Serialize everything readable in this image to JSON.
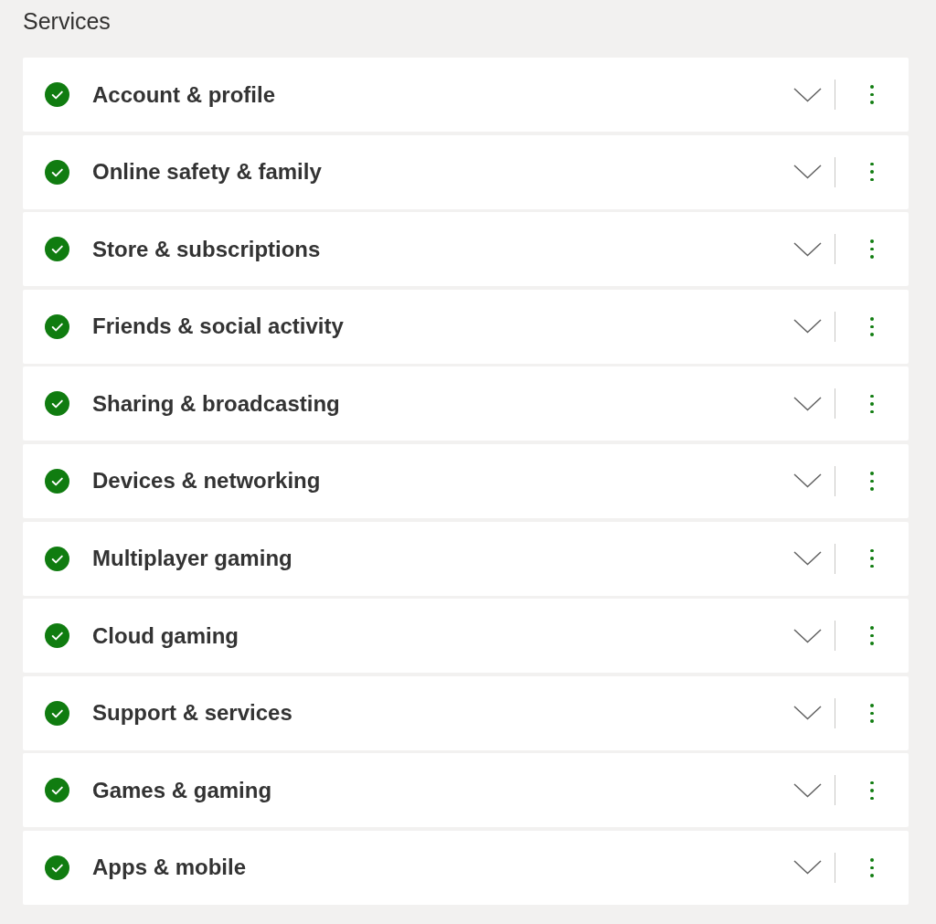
{
  "section": {
    "title": "Services"
  },
  "services": [
    {
      "name": "Account & profile",
      "healthy": true,
      "expanded": false
    },
    {
      "name": "Online safety & family",
      "healthy": true,
      "expanded": false
    },
    {
      "name": "Store & subscriptions",
      "healthy": true,
      "expanded": false
    },
    {
      "name": "Friends & social activity",
      "healthy": true,
      "expanded": false
    },
    {
      "name": "Sharing & broadcasting",
      "healthy": true,
      "expanded": false
    },
    {
      "name": "Devices & networking",
      "healthy": true,
      "expanded": false
    },
    {
      "name": "Multiplayer gaming",
      "healthy": true,
      "expanded": false
    },
    {
      "name": "Cloud gaming",
      "healthy": true,
      "expanded": false
    },
    {
      "name": "Support & services",
      "healthy": true,
      "expanded": false
    },
    {
      "name": "Games & gaming",
      "healthy": true,
      "expanded": false
    },
    {
      "name": "Apps & mobile",
      "healthy": true,
      "expanded": false
    }
  ]
}
